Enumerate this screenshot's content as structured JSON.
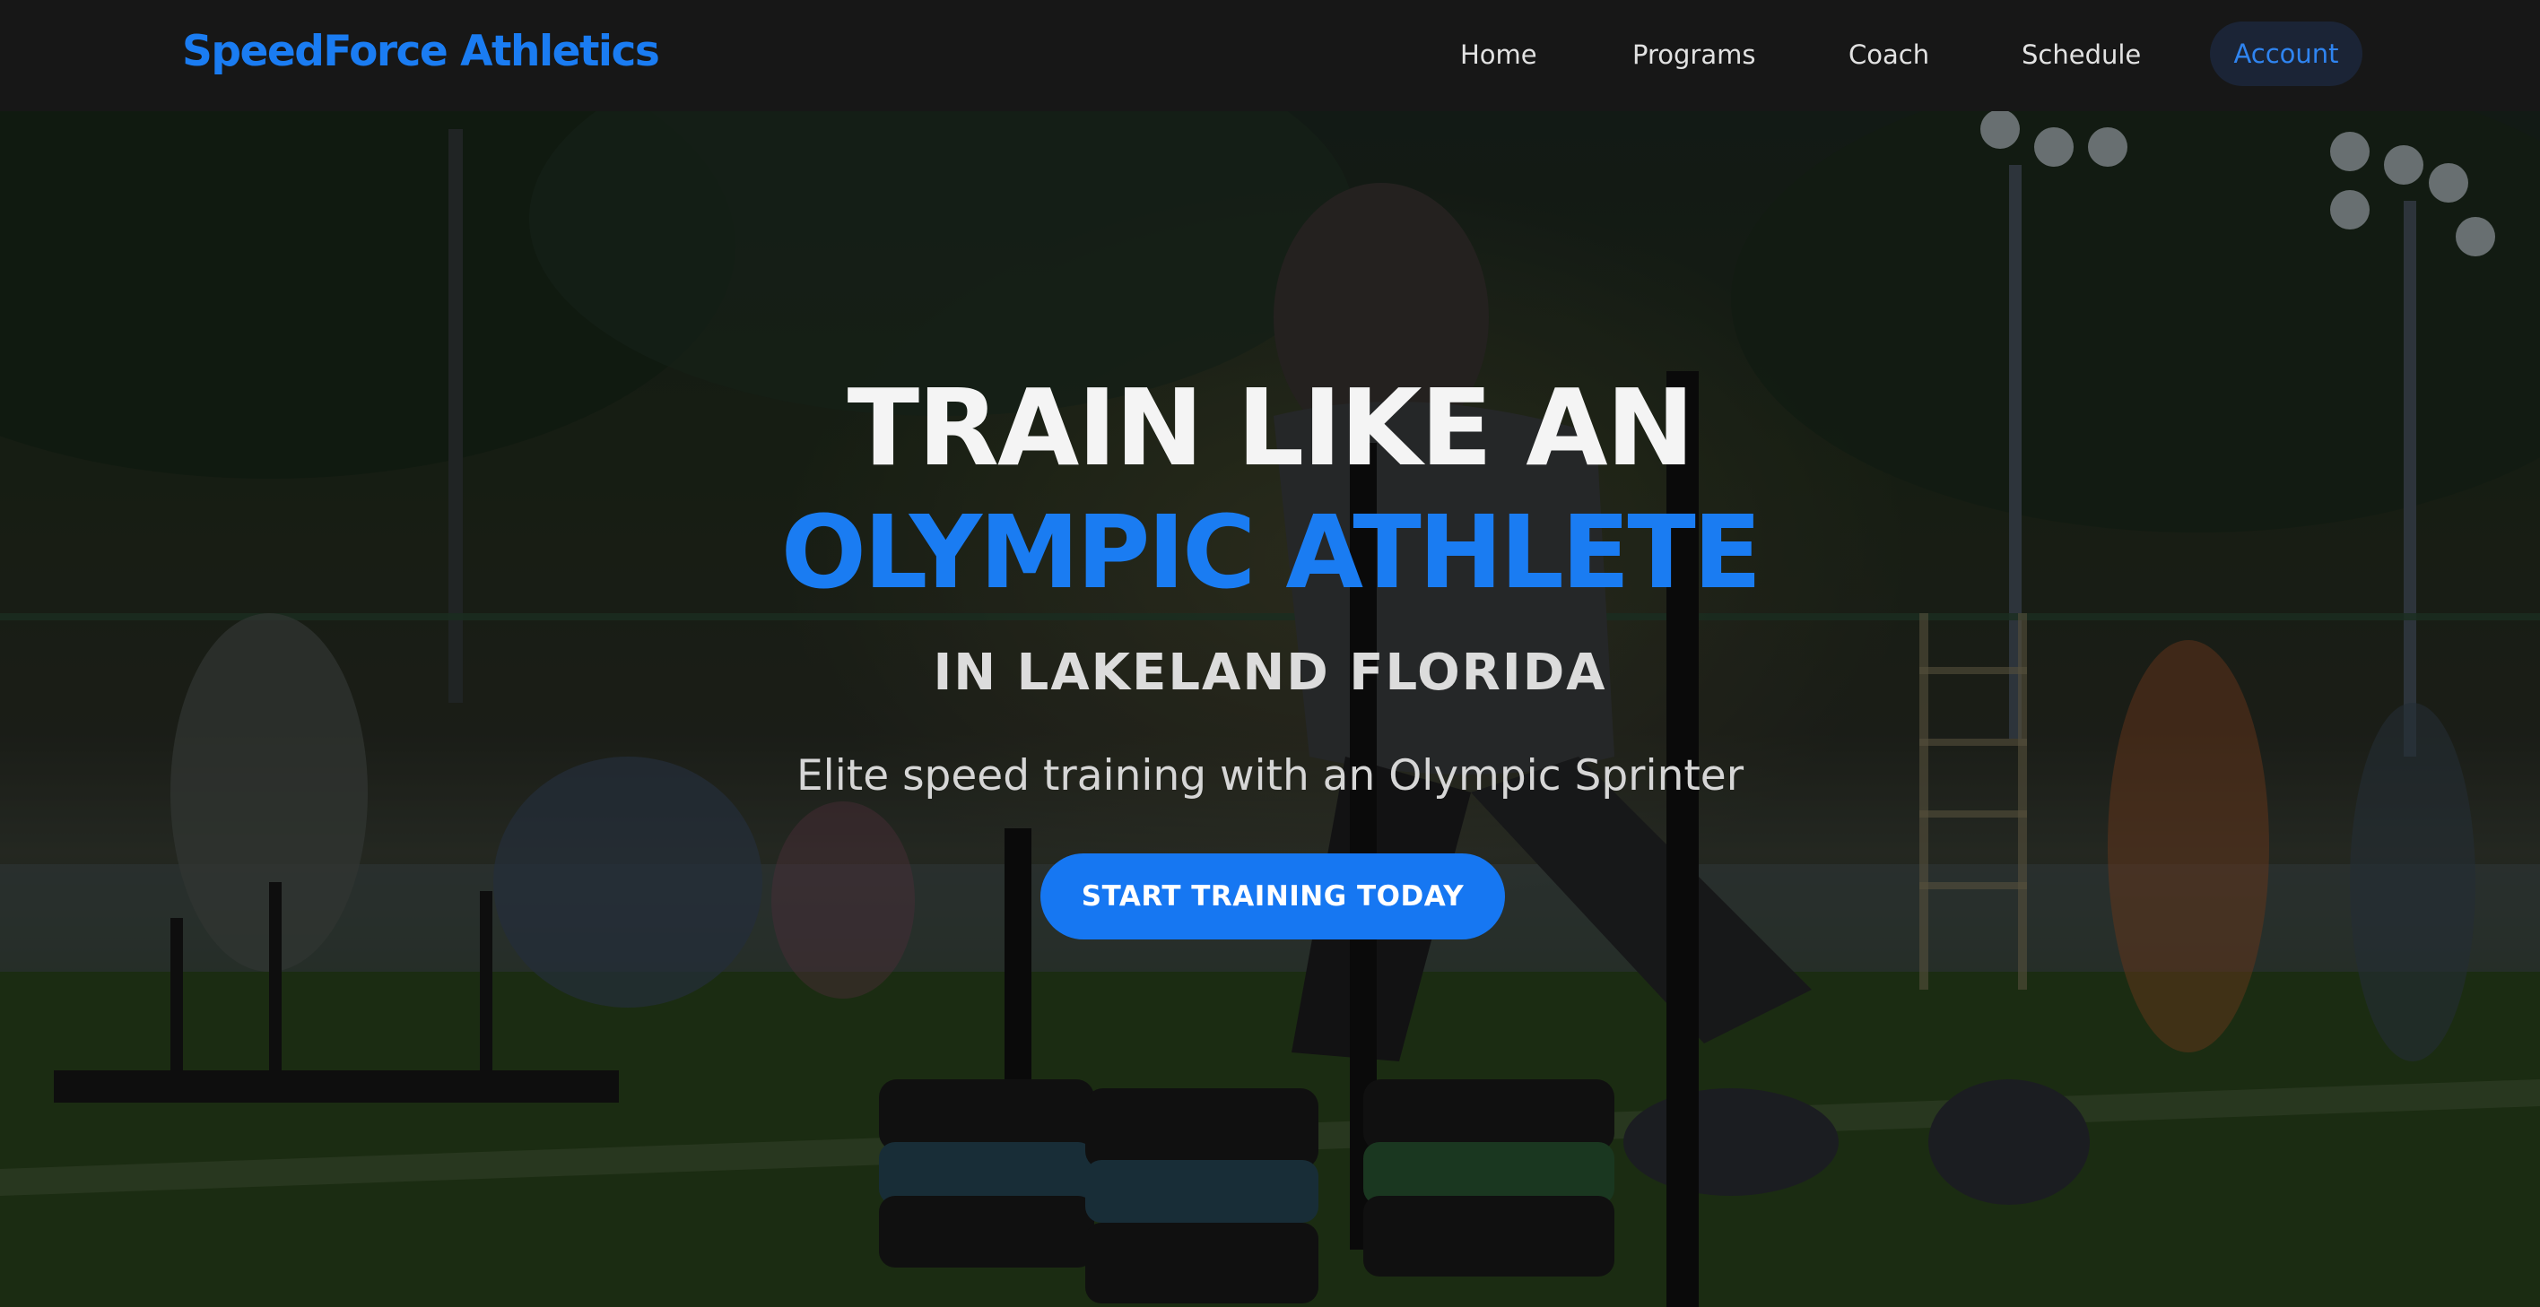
{
  "nav": {
    "brand": "SpeedForce Athletics",
    "items": [
      {
        "label": "Home"
      },
      {
        "label": "Programs"
      },
      {
        "label": "Coach"
      },
      {
        "label": "Schedule"
      }
    ],
    "account_label": "Account"
  },
  "hero": {
    "headline_line1": "TRAIN LIKE AN",
    "headline_line2": "OLYMPIC ATHLETE",
    "headline_line3": "IN LAKELAND FLORIDA",
    "tagline": "Elite speed training with an Olympic Sprinter",
    "cta_label": "START TRAINING TODAY"
  },
  "colors": {
    "accent": "#1A7CF2",
    "nav_background": "#171717",
    "account_pill": "#1B2436",
    "headline_white": "#F4F4F4"
  }
}
